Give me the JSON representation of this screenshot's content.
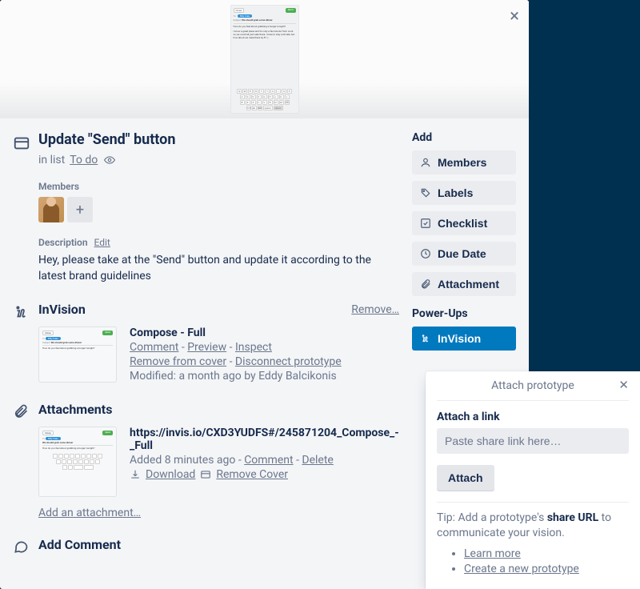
{
  "card": {
    "title": "Update \"Send\" button",
    "in_list_prefix": "in list",
    "list_name": "To do"
  },
  "members": {
    "heading": "Members"
  },
  "description": {
    "heading": "Description",
    "edit": "Edit",
    "text": "Hey, please take at the \"Send\" button and update it according to the latest brand guidelines"
  },
  "invision": {
    "heading": "InVision",
    "remove": "Remove…",
    "item": {
      "title": "Compose - Full",
      "comment": "Comment",
      "preview": "Preview",
      "inspect": "Inspect",
      "remove_cover": "Remove from cover",
      "disconnect": "Disconnect prototype",
      "modified": "Modified: a month ago by Eddy Balcikonis"
    }
  },
  "attachments": {
    "heading": "Attachments",
    "item": {
      "title": "https://invis.io/CXD3YUDFS#/245871204_Compose_-_Full",
      "added": "Added 8 minutes ago",
      "comment": "Comment",
      "delete": "Delete",
      "download": "Download",
      "remove_cover": "Remove Cover"
    },
    "add": "Add an attachment…"
  },
  "comment": {
    "heading": "Add Comment"
  },
  "sidebar": {
    "add_heading": "Add",
    "members": "Members",
    "labels": "Labels",
    "checklist": "Checklist",
    "due_date": "Due Date",
    "attachment": "Attachment",
    "powerups_heading": "Power-Ups",
    "invision": "InVision"
  },
  "popover": {
    "title": "Attach prototype",
    "attach_link_label": "Attach a link",
    "placeholder": "Paste share link here…",
    "attach_btn": "Attach",
    "tip_prefix": "Tip: Add a prototype's ",
    "tip_bold": "share URL",
    "tip_suffix": " to communicate your vision.",
    "learn_more": "Learn more",
    "create_new": "Create a new prototype"
  }
}
